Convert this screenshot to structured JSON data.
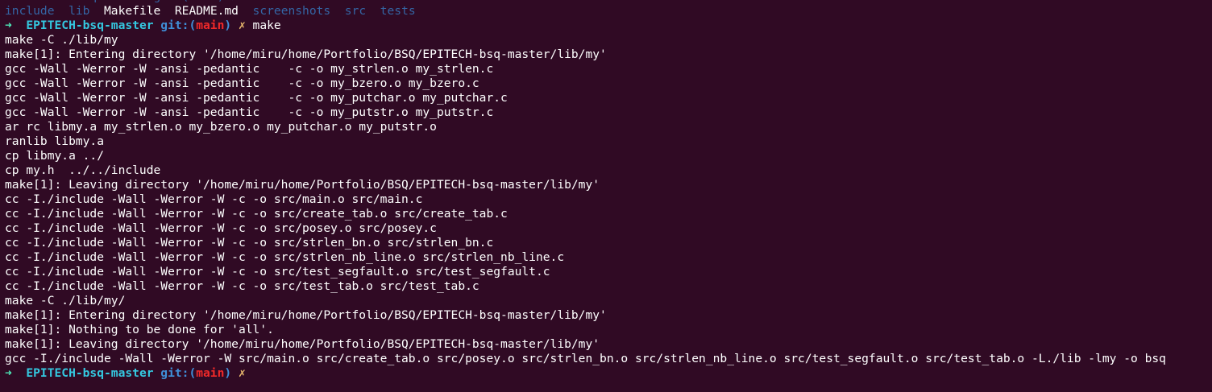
{
  "terminal": {
    "background": "#300a24",
    "lines": [
      [
        {
          "text": "  EPITECH-bsq-master git:(main) ✗ ls",
          "color": "#3465a4"
        }
      ],
      [
        {
          "text": "include",
          "color": "#3465a4"
        },
        {
          "text": "  ",
          "color": "#ffffff"
        },
        {
          "text": "lib",
          "color": "#3465a4"
        },
        {
          "text": "  Makefile  README.md  ",
          "color": "#ffffff"
        },
        {
          "text": "screenshots",
          "color": "#3465a4"
        },
        {
          "text": "  ",
          "color": "#ffffff"
        },
        {
          "text": "src",
          "color": "#3465a4"
        },
        {
          "text": "  ",
          "color": "#ffffff"
        },
        {
          "text": "tests",
          "color": "#3465a4"
        }
      ],
      [
        {
          "text": "➜  ",
          "color": "#4ee9b8",
          "bold": true
        },
        {
          "text": "EPITECH-bsq-master",
          "color": "#34c8e0",
          "bold": true
        },
        {
          "text": " git:(",
          "color": "#3f8fd8",
          "bold": true
        },
        {
          "text": "main",
          "color": "#ef2929",
          "bold": true
        },
        {
          "text": ")",
          "color": "#3f8fd8",
          "bold": true
        },
        {
          "text": " ✗ ",
          "color": "#e9b96e"
        },
        {
          "text": "make",
          "color": "#ffffff"
        }
      ],
      [
        {
          "text": "make -C ./lib/my",
          "color": "#ffffff"
        }
      ],
      [
        {
          "text": "make[1]: Entering directory '/home/miru/home/Portfolio/BSQ/EPITECH-bsq-master/lib/my'",
          "color": "#ffffff"
        }
      ],
      [
        {
          "text": "gcc -Wall -Werror -W -ansi -pedantic    -c -o my_strlen.o my_strlen.c",
          "color": "#ffffff"
        }
      ],
      [
        {
          "text": "gcc -Wall -Werror -W -ansi -pedantic    -c -o my_bzero.o my_bzero.c",
          "color": "#ffffff"
        }
      ],
      [
        {
          "text": "gcc -Wall -Werror -W -ansi -pedantic    -c -o my_putchar.o my_putchar.c",
          "color": "#ffffff"
        }
      ],
      [
        {
          "text": "gcc -Wall -Werror -W -ansi -pedantic    -c -o my_putstr.o my_putstr.c",
          "color": "#ffffff"
        }
      ],
      [
        {
          "text": "ar rc libmy.a my_strlen.o my_bzero.o my_putchar.o my_putstr.o",
          "color": "#ffffff"
        }
      ],
      [
        {
          "text": "ranlib libmy.a",
          "color": "#ffffff"
        }
      ],
      [
        {
          "text": "cp libmy.a ../",
          "color": "#ffffff"
        }
      ],
      [
        {
          "text": "cp my.h  ../../include",
          "color": "#ffffff"
        }
      ],
      [
        {
          "text": "make[1]: Leaving directory '/home/miru/home/Portfolio/BSQ/EPITECH-bsq-master/lib/my'",
          "color": "#ffffff"
        }
      ],
      [
        {
          "text": "cc -I./include -Wall -Werror -W -c -o src/main.o src/main.c",
          "color": "#ffffff"
        }
      ],
      [
        {
          "text": "cc -I./include -Wall -Werror -W -c -o src/create_tab.o src/create_tab.c",
          "color": "#ffffff"
        }
      ],
      [
        {
          "text": "cc -I./include -Wall -Werror -W -c -o src/posey.o src/posey.c",
          "color": "#ffffff"
        }
      ],
      [
        {
          "text": "cc -I./include -Wall -Werror -W -c -o src/strlen_bn.o src/strlen_bn.c",
          "color": "#ffffff"
        }
      ],
      [
        {
          "text": "cc -I./include -Wall -Werror -W -c -o src/strlen_nb_line.o src/strlen_nb_line.c",
          "color": "#ffffff"
        }
      ],
      [
        {
          "text": "cc -I./include -Wall -Werror -W -c -o src/test_segfault.o src/test_segfault.c",
          "color": "#ffffff"
        }
      ],
      [
        {
          "text": "cc -I./include -Wall -Werror -W -c -o src/test_tab.o src/test_tab.c",
          "color": "#ffffff"
        }
      ],
      [
        {
          "text": "make -C ./lib/my/",
          "color": "#ffffff"
        }
      ],
      [
        {
          "text": "make[1]: Entering directory '/home/miru/home/Portfolio/BSQ/EPITECH-bsq-master/lib/my'",
          "color": "#ffffff"
        }
      ],
      [
        {
          "text": "make[1]: Nothing to be done for 'all'.",
          "color": "#ffffff"
        }
      ],
      [
        {
          "text": "make[1]: Leaving directory '/home/miru/home/Portfolio/BSQ/EPITECH-bsq-master/lib/my'",
          "color": "#ffffff"
        }
      ],
      [
        {
          "text": "gcc -I./include -Wall -Werror -W src/main.o src/create_tab.o src/posey.o src/strlen_bn.o src/strlen_nb_line.o src/test_segfault.o src/test_tab.o -L./lib -lmy -o bsq",
          "color": "#ffffff"
        }
      ],
      [
        {
          "text": "➜  ",
          "color": "#4ee9b8",
          "bold": true
        },
        {
          "text": "EPITECH-bsq-master",
          "color": "#34c8e0",
          "bold": true
        },
        {
          "text": " git:(",
          "color": "#3f8fd8",
          "bold": true
        },
        {
          "text": "main",
          "color": "#ef2929",
          "bold": true
        },
        {
          "text": ")",
          "color": "#3f8fd8",
          "bold": true
        },
        {
          "text": " ✗ ",
          "color": "#e9b96e"
        }
      ]
    ]
  }
}
